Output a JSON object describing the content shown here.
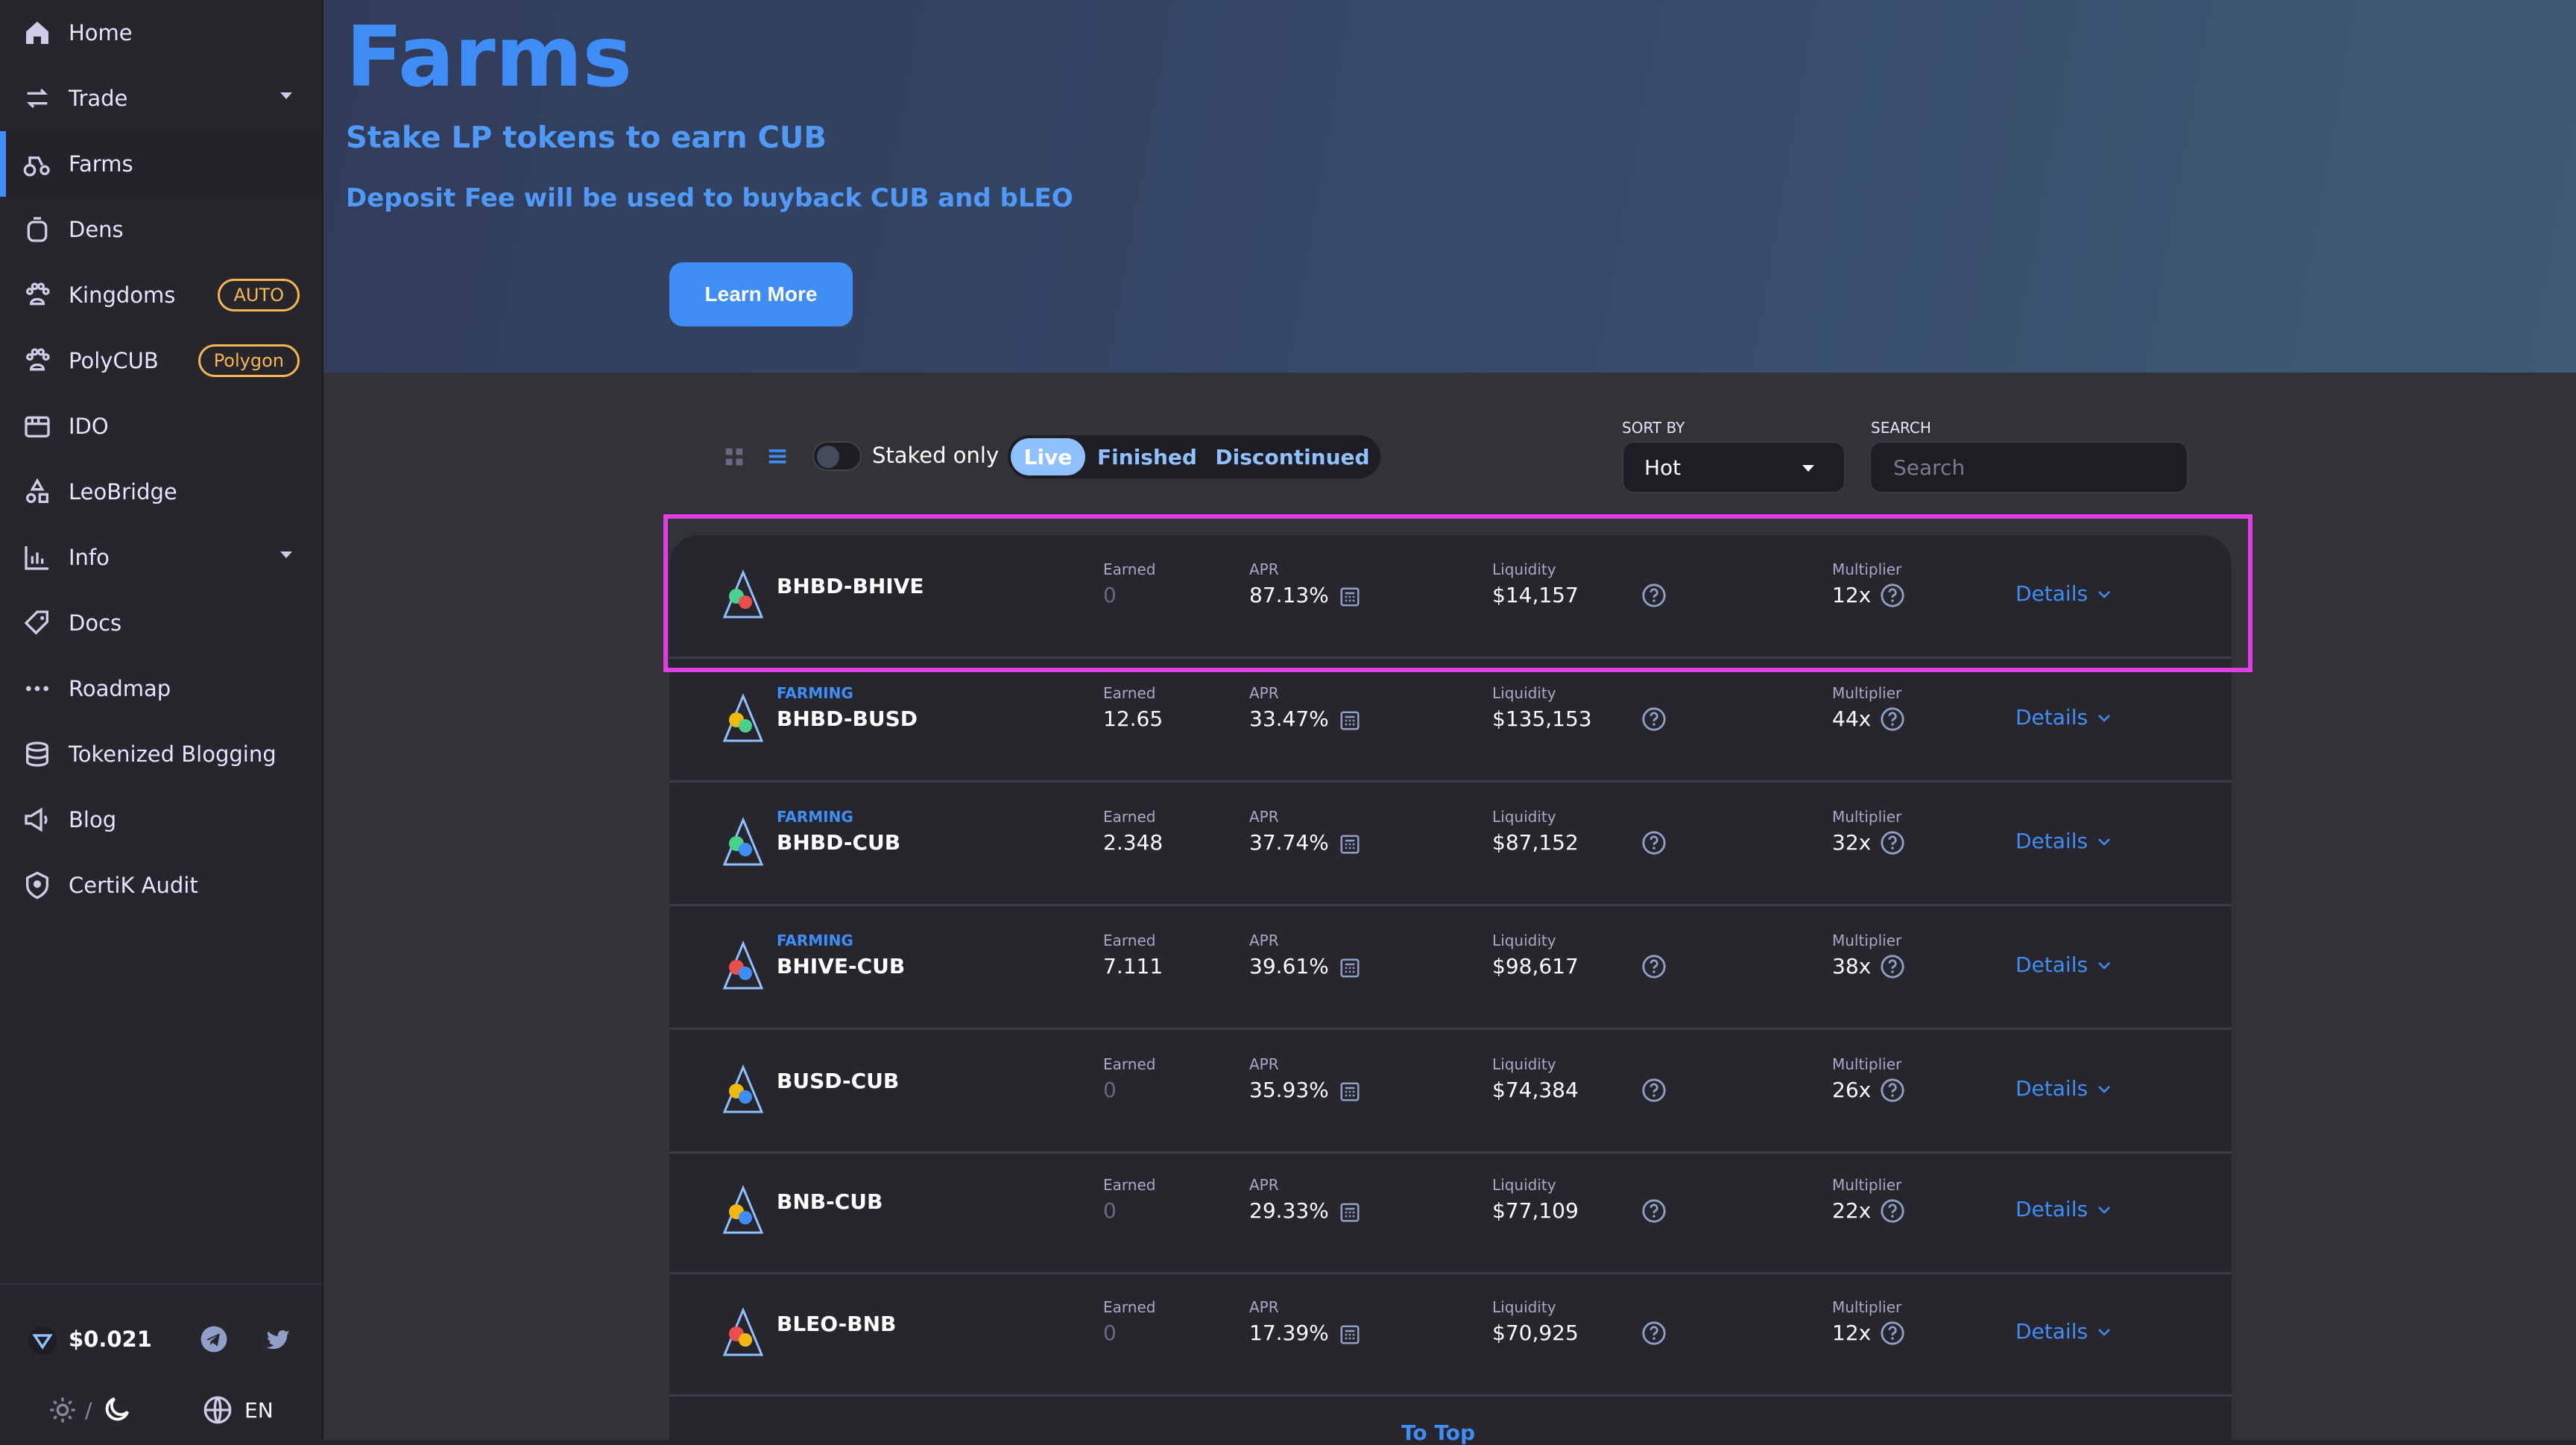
{
  "sidebar": {
    "items": [
      {
        "label": "Home",
        "icon": "home-icon"
      },
      {
        "label": "Trade",
        "icon": "trade-icon"
      },
      {
        "label": "Farms",
        "icon": "farms-icon"
      },
      {
        "label": "Dens",
        "icon": "dens-icon"
      },
      {
        "label": "Kingdoms",
        "icon": "kingdoms-icon",
        "badge": "AUTO"
      },
      {
        "label": "PolyCUB",
        "icon": "polycub-icon",
        "badge": "Polygon"
      },
      {
        "label": "IDO",
        "icon": "ido-icon"
      },
      {
        "label": "LeoBridge",
        "icon": "leobridge-icon"
      },
      {
        "label": "Info",
        "icon": "info-icon"
      },
      {
        "label": "Docs",
        "icon": "docs-icon"
      },
      {
        "label": "Roadmap",
        "icon": "roadmap-icon"
      },
      {
        "label": "Tokenized Blogging",
        "icon": "tokenized-blogging-icon"
      },
      {
        "label": "Blog",
        "icon": "blog-icon"
      },
      {
        "label": "CertiK Audit",
        "icon": "certik-icon"
      }
    ],
    "footer": {
      "price": "$0.021",
      "theme_separator": "/",
      "language": "EN"
    }
  },
  "hero": {
    "title": "Farms",
    "subtitle": "Stake LP tokens to earn CUB",
    "note": "Deposit Fee will be used to buyback CUB and bLEO",
    "button": "Learn More"
  },
  "controls": {
    "staked_only": "Staked only",
    "tabs": [
      "Live",
      "Finished",
      "Discontinued"
    ],
    "sort_label": "SORT BY",
    "sort_value": "Hot",
    "search_label": "SEARCH",
    "search_placeholder": "Search"
  },
  "table": {
    "labels": {
      "earned": "Earned",
      "apr": "APR",
      "liquidity": "Liquidity",
      "multiplier": "Multiplier",
      "details": "Details"
    },
    "rows": [
      {
        "tag": "",
        "pair": "BHBD-BHIVE",
        "earned": "0",
        "apr": "87.13%",
        "liquidity": "$14,157",
        "multiplier": "12x"
      },
      {
        "tag": "FARMING",
        "pair": "BHBD-BUSD",
        "earned": "12.65",
        "apr": "33.47%",
        "liquidity": "$135,153",
        "multiplier": "44x"
      },
      {
        "tag": "FARMING",
        "pair": "BHBD-CUB",
        "earned": "2.348",
        "apr": "37.74%",
        "liquidity": "$87,152",
        "multiplier": "32x"
      },
      {
        "tag": "FARMING",
        "pair": "BHIVE-CUB",
        "earned": "7.111",
        "apr": "39.61%",
        "liquidity": "$98,617",
        "multiplier": "38x"
      },
      {
        "tag": "",
        "pair": "BUSD-CUB",
        "earned": "0",
        "apr": "35.93%",
        "liquidity": "$74,384",
        "multiplier": "26x"
      },
      {
        "tag": "",
        "pair": "BNB-CUB",
        "earned": "0",
        "apr": "29.33%",
        "liquidity": "$77,109",
        "multiplier": "22x"
      },
      {
        "tag": "",
        "pair": "BLEO-BNB",
        "earned": "0",
        "apr": "17.39%",
        "liquidity": "$70,925",
        "multiplier": "12x"
      }
    ],
    "to_top": "To Top"
  },
  "colors": {
    "accent": "#3f8ef7",
    "highlight": "#e13fe3",
    "badge": "#f6b652"
  }
}
